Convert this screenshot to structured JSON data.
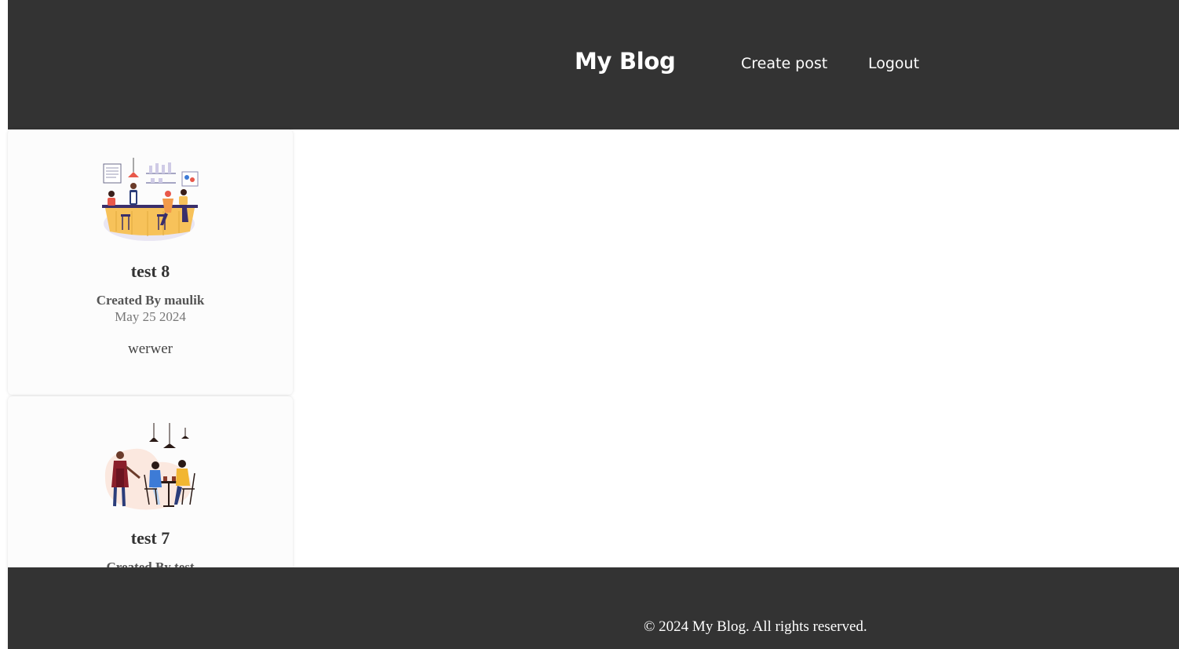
{
  "header": {
    "brand": "My Blog",
    "nav": {
      "create_post": "Create post",
      "logout": "Logout"
    }
  },
  "posts": [
    {
      "image": "restaurant-counter-illustration",
      "title": "test 8",
      "author": "Created By maulik",
      "date": "May 25 2024",
      "excerpt": "werwer"
    },
    {
      "image": "cafe-waiter-illustration",
      "title": "test 7",
      "author": "Created By test"
    }
  ],
  "footer": {
    "copyright": "© 2024 My Blog. All rights reserved."
  }
}
